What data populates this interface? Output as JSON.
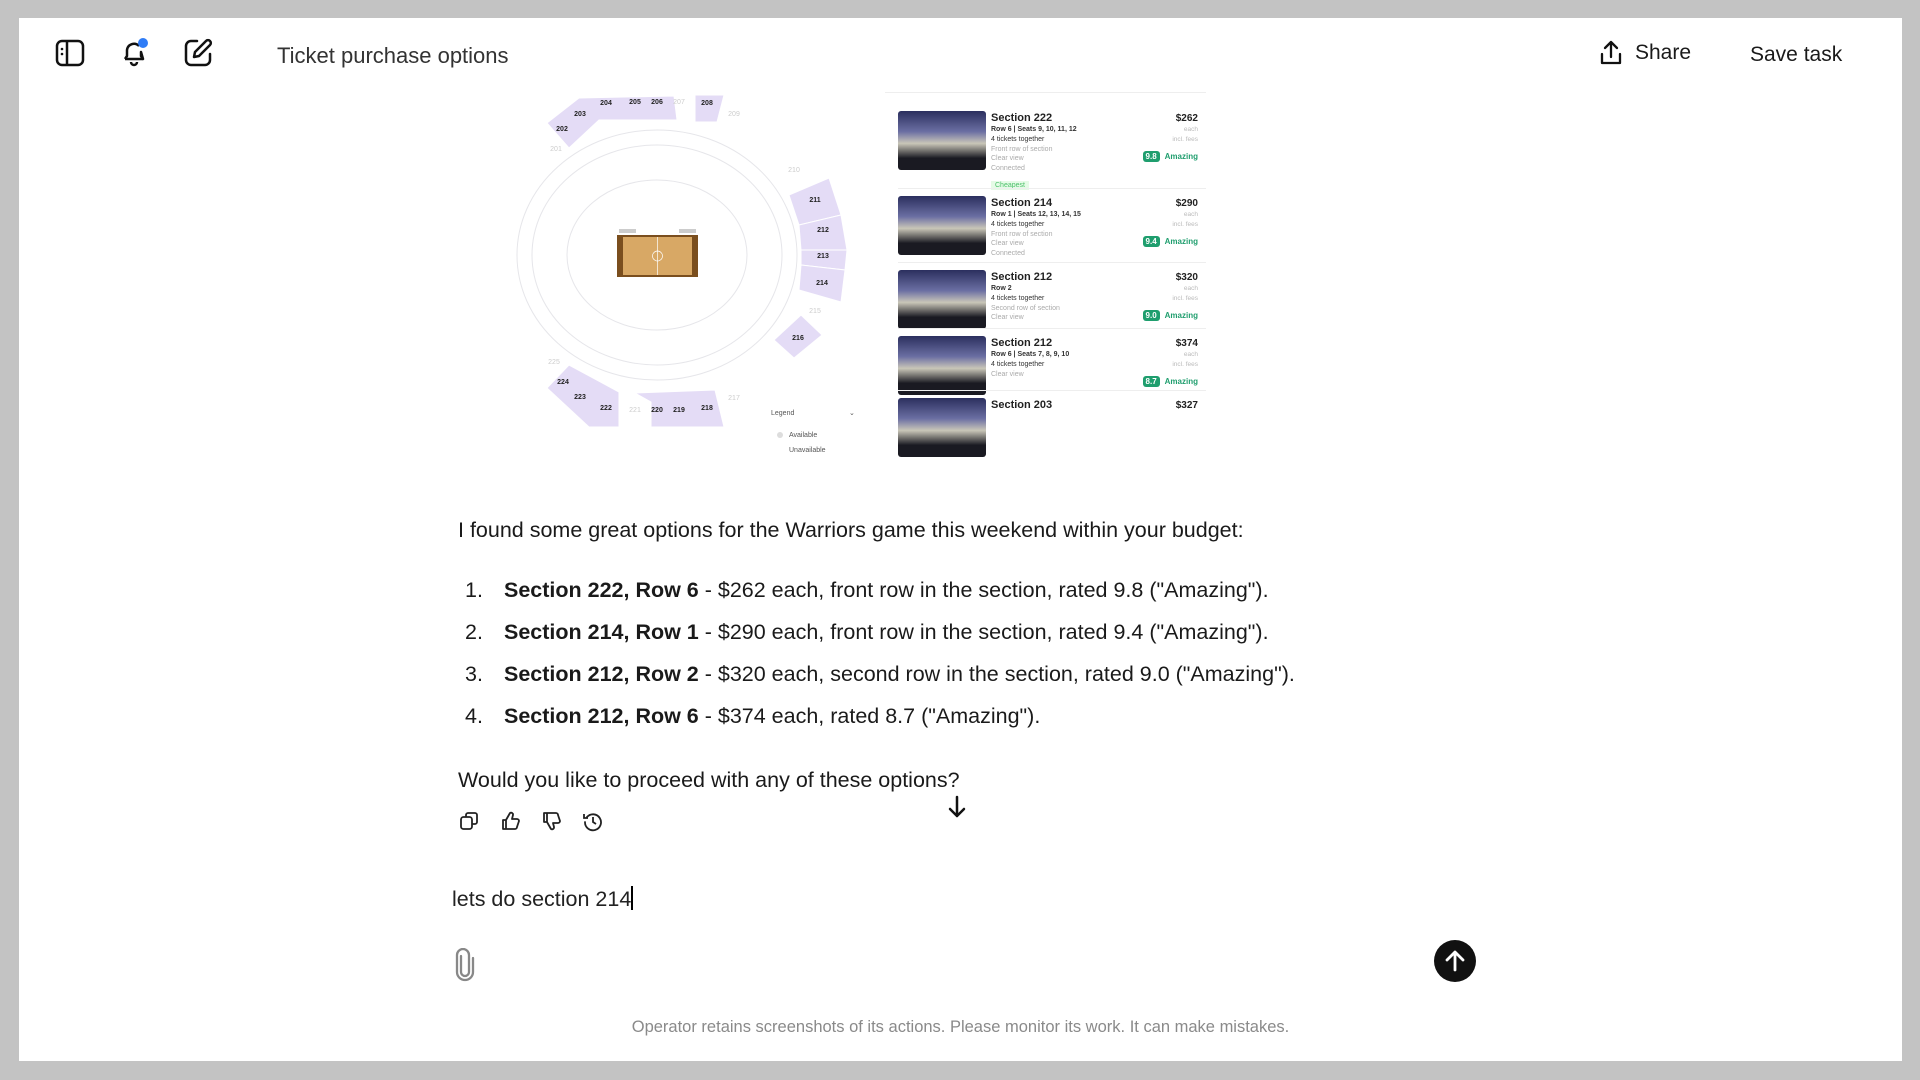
{
  "header": {
    "title": "Ticket purchase options",
    "share_label": "Share",
    "save_label": "Save task",
    "notification_dot_color": "#2f7cf6"
  },
  "seat_map": {
    "available_sections": [
      "202",
      "203",
      "204",
      "205",
      "206",
      "208",
      "211",
      "212",
      "213",
      "214",
      "216",
      "218",
      "219",
      "220",
      "222",
      "223",
      "224"
    ],
    "unavailable_sections": [
      "207",
      "209",
      "210",
      "215",
      "217",
      "221",
      "225",
      "201"
    ],
    "legend_title": "Legend",
    "legend_available": "Available",
    "legend_unavailable": "Unavailable",
    "available_color": "#e4dcf6"
  },
  "listings": [
    {
      "section": "Section 222",
      "row": "Row 6 | Seats 9, 10, 11, 12",
      "features": [
        "4 tickets together",
        "Front row of section",
        "Clear view",
        "Connected"
      ],
      "badge": "Cheapest",
      "price": "$262",
      "each": "each",
      "fees": "incl. fees",
      "score": "9.8",
      "rating": "Amazing"
    },
    {
      "section": "Section 214",
      "row": "Row 1 | Seats 12, 13, 14, 15",
      "features": [
        "4 tickets together",
        "Front row of section",
        "Clear view",
        "Connected"
      ],
      "price": "$290",
      "each": "each",
      "fees": "incl. fees",
      "score": "9.4",
      "rating": "Amazing"
    },
    {
      "section": "Section 212",
      "row": "Row 2",
      "features": [
        "4 tickets together",
        "Second row of section",
        "Clear view"
      ],
      "price": "$320",
      "each": "each",
      "fees": "incl. fees",
      "score": "9.0",
      "rating": "Amazing"
    },
    {
      "section": "Section 212",
      "row": "Row 6 | Seats 7, 8, 9, 10",
      "features": [
        "4 tickets together",
        "Clear view"
      ],
      "price": "$374",
      "each": "each",
      "fees": "incl. fees",
      "score": "8.7",
      "rating": "Amazing"
    },
    {
      "section": "Section 203",
      "price": "$327"
    }
  ],
  "message": {
    "intro": "I found some great options for the Warriors game this weekend within your budget:",
    "items": [
      {
        "num": "1.",
        "bold": "Section 222, Row 6",
        "rest": " - $262 each, front row in the section, rated 9.8 (\"Amazing\")."
      },
      {
        "num": "2.",
        "bold": "Section 214, Row 1",
        "rest": " - $290 each, front row in the section, rated 9.4 (\"Amazing\")."
      },
      {
        "num": "3.",
        "bold": "Section 212, Row 2",
        "rest": " - $320 each, second row in the section, rated 9.0 (\"Amazing\")."
      },
      {
        "num": "4.",
        "bold": "Section 212, Row 6",
        "rest": " - $374 each, rated 8.7 (\"Amazing\")."
      }
    ],
    "question": "Would you like to proceed with any of these options?"
  },
  "composer": {
    "value": "lets do section 214"
  },
  "footer": "Operator retains screenshots of its actions. Please monitor its work. It can make mistakes."
}
